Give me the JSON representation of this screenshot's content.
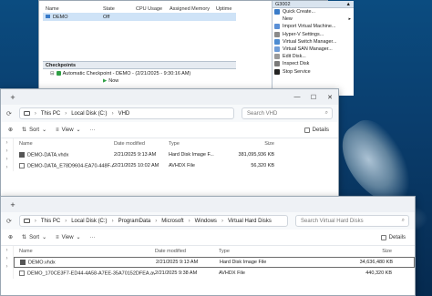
{
  "hyperv": {
    "columns": [
      "Name",
      "State",
      "CPU Usage",
      "Assigned Memory",
      "Uptime"
    ],
    "vms": [
      {
        "name": "DEMO",
        "state": "Off",
        "cpu": "",
        "memory": "",
        "uptime": ""
      }
    ],
    "checkpoints_title": "Checkpoints",
    "checkpoint_item": "Automatic Checkpoint - DEMO - (2/21/2025 - 9:30:16 AM)",
    "now_label": "Now"
  },
  "actions": {
    "header": "G3002",
    "items": [
      {
        "label": "Quick Create...",
        "icon_color": "#3a7bc8",
        "sub": ""
      },
      {
        "label": "New",
        "icon_color": "#ffffff",
        "sub": "▸"
      },
      {
        "label": "Import Virtual Machine...",
        "icon_color": "#5a8fd6",
        "sub": ""
      },
      {
        "label": "Hyper-V Settings...",
        "icon_color": "#8a8a8a",
        "sub": ""
      },
      {
        "label": "Virtual Switch Manager...",
        "icon_color": "#4c8bd1",
        "sub": ""
      },
      {
        "label": "Virtual SAN Manager...",
        "icon_color": "#6e9cd8",
        "sub": ""
      },
      {
        "label": "Edit Disk...",
        "icon_color": "#9a9a9a",
        "sub": ""
      },
      {
        "label": "Inspect Disk",
        "icon_color": "#7a7a7a",
        "sub": ""
      },
      {
        "label": "Stop Service",
        "icon_color": "#222222",
        "sub": ""
      }
    ]
  },
  "explorer1": {
    "breadcrumb": [
      "This PC",
      "Local Disk (C:)",
      "VHD"
    ],
    "search_placeholder": "Search VHD",
    "toolbar": {
      "sort": "Sort",
      "view": "View",
      "more": "···",
      "details": "Details"
    },
    "columns": {
      "name": "Name",
      "date": "Date modified",
      "type": "Type",
      "size": "Size"
    },
    "files": [
      {
        "name": "DEMO-DATA.vhdx",
        "date": "2/21/2025 9:13 AM",
        "type": "Hard Disk Image F...",
        "size": "381,095,936 KB",
        "kind": "vhdx"
      },
      {
        "name": "DEMO-DATA_E78D9604-EA70-448F-AA7...",
        "date": "2/21/2025 10:02 AM",
        "type": "AVHDX File",
        "size": "56,320 KB",
        "kind": "avhdx"
      }
    ]
  },
  "explorer2": {
    "breadcrumb": [
      "This PC",
      "Local Disk (C:)",
      "ProgramData",
      "Microsoft",
      "Windows",
      "Virtual Hard Disks"
    ],
    "search_placeholder": "Search Virtual Hard Disks",
    "toolbar": {
      "sort": "Sort",
      "view": "View",
      "more": "···",
      "details": "Details"
    },
    "columns": {
      "name": "Name",
      "date": "Date modified",
      "type": "Type",
      "size": "Size"
    },
    "files": [
      {
        "name": "DEMO.vhdx",
        "date": "2/21/2025 9:13 AM",
        "type": "Hard Disk Image File",
        "size": "34,636,480 KB",
        "kind": "vhdx",
        "selected": true
      },
      {
        "name": "DEMO_170CE3F7-ED44-4A58-A7EE-35A70152DFEA.avhdx",
        "date": "2/21/2025 9:38 AM",
        "type": "AVHDX File",
        "size": "440,320 KB",
        "kind": "avhdx",
        "selected": false
      }
    ]
  }
}
